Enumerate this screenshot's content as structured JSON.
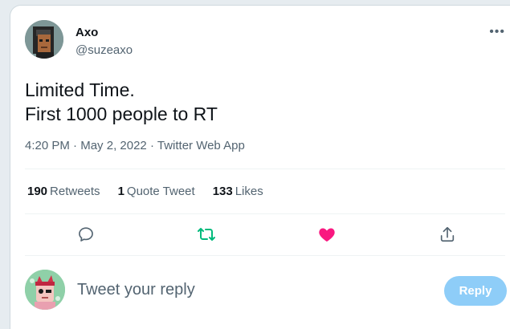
{
  "tweet": {
    "author_name": "Axo",
    "author_handle": "@suzeaxo",
    "more_label": "•••",
    "text_line1": "Limited Time.",
    "text_line2": "First 1000 people to RT",
    "time": "4:20 PM",
    "date": "May 2, 2022",
    "source": "Twitter Web App",
    "dot": "·"
  },
  "stats": {
    "retweets_count": "190",
    "retweets_label": "Retweets",
    "quotes_count": "1",
    "quotes_label": "Quote Tweet",
    "likes_count": "133",
    "likes_label": "Likes"
  },
  "actions": {
    "reply_icon": "speech-bubble-icon",
    "retweet_icon": "retweet-icon",
    "like_icon": "heart-icon",
    "share_icon": "share-icon",
    "retweet_color": "#00ba7c",
    "like_color": "#f91880"
  },
  "reply_box": {
    "placeholder": "Tweet your reply",
    "button_label": "Reply"
  }
}
